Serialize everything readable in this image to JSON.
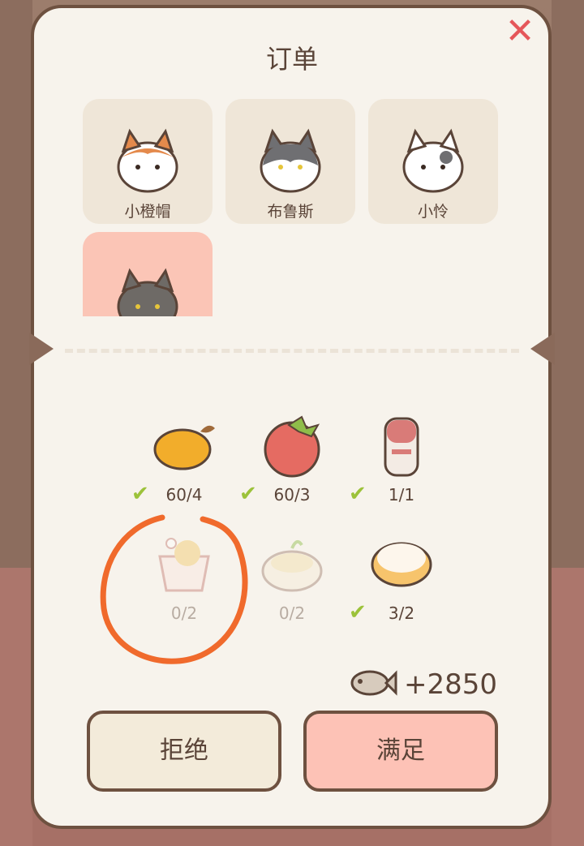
{
  "dialog": {
    "title": "订单",
    "close_icon": "close-icon"
  },
  "cats": [
    {
      "name": "小橙帽",
      "color": "#e48a4c"
    },
    {
      "name": "布鲁斯",
      "color": "#6f6f72"
    },
    {
      "name": "小怜",
      "color": "#f2a7a7"
    },
    {
      "name": "",
      "color": "#6e6a66"
    }
  ],
  "items": [
    {
      "icon": "mango-icon",
      "count": "60/4",
      "done": true
    },
    {
      "icon": "tomato-icon",
      "count": "60/3",
      "done": true
    },
    {
      "icon": "milk-bottle-icon",
      "count": "1/1",
      "done": true
    },
    {
      "icon": "fried-chicken-icon",
      "count": "0/2",
      "done": false
    },
    {
      "icon": "mashed-potato-icon",
      "count": "0/2",
      "done": false
    },
    {
      "icon": "pudding-icon",
      "count": "3/2",
      "done": true
    }
  ],
  "reward": {
    "icon": "fish-icon",
    "value": "+2850"
  },
  "buttons": {
    "reject": "拒绝",
    "accept": "满足"
  },
  "colors": {
    "accent": "#fdc2b6",
    "check": "#9cc23a",
    "annotation": "#f06a2c"
  }
}
